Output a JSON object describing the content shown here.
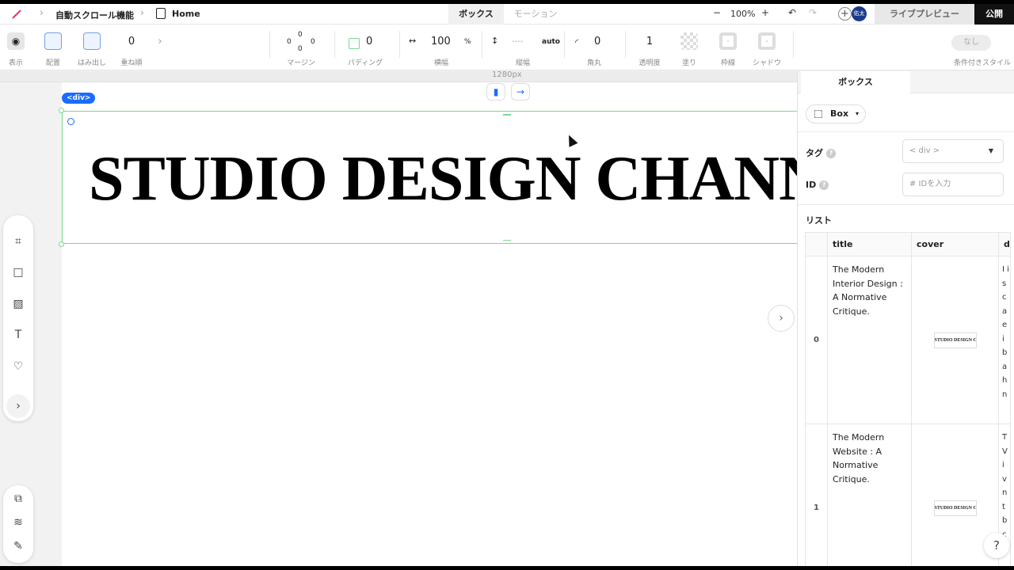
{
  "breadcrumb": {
    "project": "自動スクロール機能",
    "page": "Home"
  },
  "mode_tabs": {
    "box": "ボックス",
    "motion": "モーション"
  },
  "zoom": {
    "minus": "−",
    "value": "100%",
    "plus": "+"
  },
  "history": {
    "undo": "↶",
    "redo": "↷"
  },
  "user": {
    "avatar_text": "佑太",
    "add": "+"
  },
  "header_actions": {
    "live_preview": "ライブプレビュー",
    "publish": "公開"
  },
  "toolbar": {
    "display": "表示",
    "placement": "配置",
    "overflow": "はみ出し",
    "zindex_value": "0",
    "zindex": "重ね順",
    "more": "›",
    "margin": "マージン",
    "margin_values": {
      "top": "0",
      "left": "0",
      "right": "0",
      "bottom": "0"
    },
    "padding_value": "0",
    "padding": "パディング",
    "width_value": "100",
    "width_unit": "%",
    "width": "横幅",
    "height_value": "----",
    "height_unit": "auto",
    "height": "縦幅",
    "radius_value": "0",
    "radius": "角丸",
    "opacity_value": "1",
    "opacity": "透明度",
    "fill": "塗り",
    "border": "枠線",
    "shadow": "シャドウ",
    "conditional_value": "なし",
    "conditional": "条件付きスタイル"
  },
  "canvas": {
    "ruler_label": "1280px",
    "element_badge": "<div>",
    "heading_text": "STUDIO DESIGN CHANNEL",
    "expand": "›"
  },
  "left_tools": {
    "frame": "⌗",
    "box": "□",
    "image": "▨",
    "text": "T",
    "favorite": "♡",
    "more": "›",
    "pages": "⧉",
    "layers": "≋",
    "edit": "✎"
  },
  "panel": {
    "tab": "ボックス",
    "box_type": "Box",
    "tag_label": "タグ",
    "tag_value": "< div >",
    "id_label": "ID",
    "id_placeholder": "# IDを入力",
    "list_label": "リスト",
    "list_headers": [
      "title",
      "cover",
      "d"
    ],
    "list_rows": [
      {
        "index": "0",
        "title": "The Modern Interior Design : A Normative Critique.",
        "cover": "STUDIO DESIGN CHANNEL",
        "desc": "I i s c a e i b a h n"
      },
      {
        "index": "1",
        "title": "The Modern Website : A Normative Critique.",
        "cover": "STUDIO DESIGN CHANNEL",
        "desc": "T V i v n t b c"
      }
    ],
    "help": "?"
  },
  "colors": {
    "accent": "#1a6cff",
    "selection": "#7bd88f",
    "brand_pen": "#e8346c",
    "publish_bg": "#111111"
  }
}
